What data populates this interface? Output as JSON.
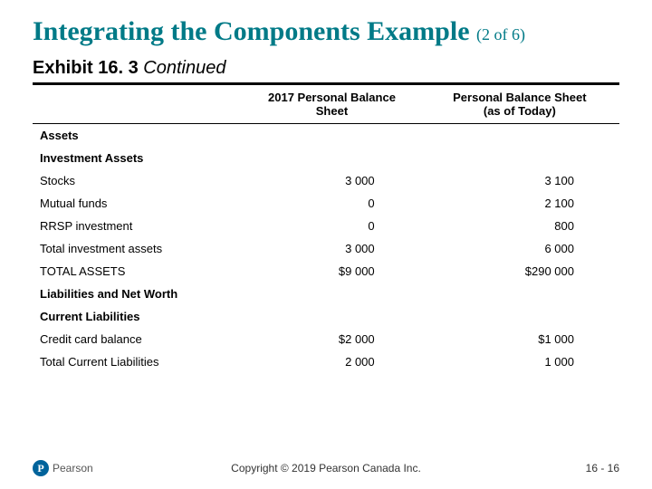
{
  "title_main": "Integrating the Components Example",
  "title_suffix": "(2 of 6)",
  "exhibit_label": "Exhibit 16. 3",
  "exhibit_cont": "Continued",
  "col_headers": {
    "c1": "2017 Personal Balance Sheet",
    "c2_line1": "Personal Balance Sheet",
    "c2_line2": "(as of Today)"
  },
  "sections": {
    "assets": "Assets",
    "investment_assets": "Investment Assets",
    "liabilities_networth": "Liabilities and Net Worth",
    "current_liabilities": "Current Liabilities"
  },
  "rows": {
    "stocks": {
      "label": "Stocks",
      "c1": "3 000",
      "c2": "3 100"
    },
    "mutual": {
      "label": "Mutual funds",
      "c1": "0",
      "c2": "2 100"
    },
    "rrsp": {
      "label": "RRSP investment",
      "c1": "0",
      "c2": "800"
    },
    "total_inv": {
      "label": "Total investment assets",
      "c1": "3 000",
      "c2": "6 000"
    },
    "total_assets": {
      "label": "TOTAL ASSETS",
      "c1": "$9 000",
      "c2": "$290 000"
    },
    "cc_balance": {
      "label": "Credit card balance",
      "c1": "$2 000",
      "c2": "$1 000"
    },
    "total_cl": {
      "label": "Total Current Liabilities",
      "c1": "2 000",
      "c2": "1 000"
    }
  },
  "footer": {
    "publisher": "Pearson",
    "copyright": "Copyright © 2019 Pearson Canada Inc.",
    "pagenum": "16 - 16"
  },
  "chart_data": {
    "type": "table",
    "title": "Personal Balance Sheet comparison",
    "columns": [
      "Item",
      "2017 Personal Balance Sheet",
      "Personal Balance Sheet (as of Today)"
    ],
    "rows": [
      [
        "Stocks",
        3000,
        3100
      ],
      [
        "Mutual funds",
        0,
        2100
      ],
      [
        "RRSP investment",
        0,
        800
      ],
      [
        "Total investment assets",
        3000,
        6000
      ],
      [
        "TOTAL ASSETS",
        9000,
        290000
      ],
      [
        "Credit card balance",
        2000,
        1000
      ],
      [
        "Total Current Liabilities",
        2000,
        1000
      ]
    ]
  }
}
